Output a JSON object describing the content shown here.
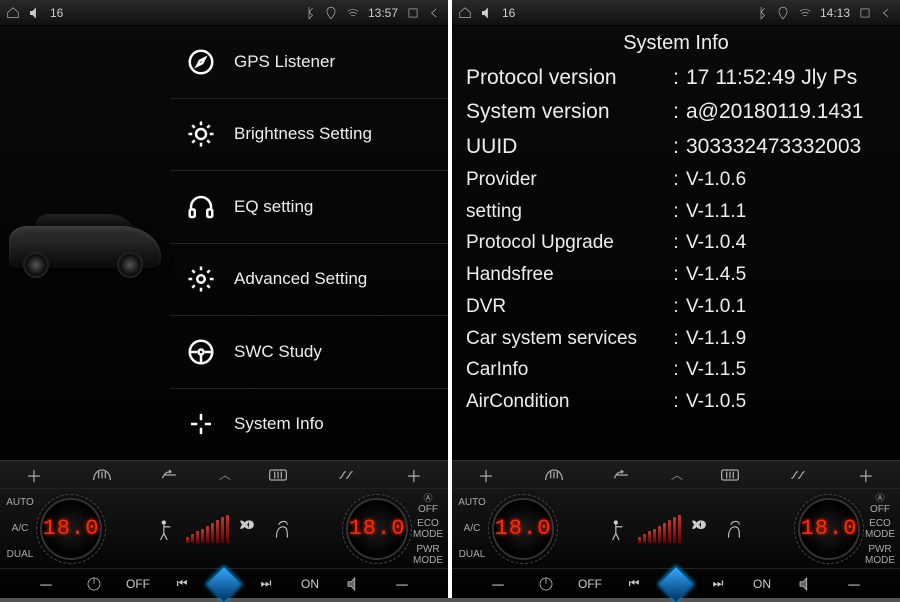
{
  "left": {
    "status": {
      "volume": "16",
      "time": "13:57"
    },
    "menu": [
      {
        "label": "GPS Listener"
      },
      {
        "label": "Brightness Setting"
      },
      {
        "label": "EQ setting"
      },
      {
        "label": "Advanced Setting"
      },
      {
        "label": "SWC Study"
      },
      {
        "label": "System Info"
      }
    ],
    "climate": {
      "auto": "AUTO",
      "ac": "A/C",
      "dual": "DUAL",
      "aoff": "OFF",
      "eco": "ECO",
      "mode": "MODE",
      "pwr": "PWR",
      "off": "OFF",
      "on": "ON",
      "tempL": "18.0",
      "tempR": "18.0"
    }
  },
  "right": {
    "status": {
      "volume": "16",
      "time": "14:13"
    },
    "title": "System Info",
    "info": [
      {
        "k": "Protocol version",
        "v": "17 11:52:49 Jly Ps",
        "big": true
      },
      {
        "k": "System version",
        "v": "a@20180119.1431",
        "big": true
      },
      {
        "k": "UUID",
        "v": "303332473332003",
        "big": true
      },
      {
        "k": "Provider",
        "v": "V-1.0.6"
      },
      {
        "k": "setting",
        "v": "V-1.1.1"
      },
      {
        "k": "Protocol Upgrade",
        "v": "V-1.0.4"
      },
      {
        "k": "Handsfree",
        "v": "V-1.4.5"
      },
      {
        "k": "DVR",
        "v": "V-1.0.1"
      },
      {
        "k": "Car system services",
        "v": "V-1.1.9"
      },
      {
        "k": "CarInfo",
        "v": "V-1.1.5"
      },
      {
        "k": "AirCondition",
        "v": "V-1.0.5"
      }
    ],
    "climate": {
      "auto": "AUTO",
      "ac": "A/C",
      "dual": "DUAL",
      "aoff": "OFF",
      "eco": "ECO",
      "mode": "MODE",
      "pwr": "PWR",
      "off": "OFF",
      "on": "ON",
      "tempL": "18.0",
      "tempR": "18.0"
    }
  }
}
